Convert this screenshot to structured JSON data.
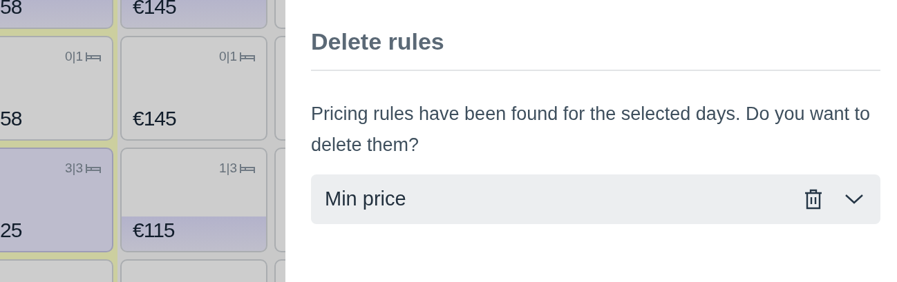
{
  "calendar": {
    "rows": [
      {
        "cells": [
          {
            "price": "58",
            "selected": false,
            "rule": true
          },
          {
            "price": "€145",
            "selected": false,
            "rule": true
          }
        ]
      },
      {
        "cells": [
          {
            "availability": "0|1",
            "price": "58",
            "selected": false,
            "rule": false
          },
          {
            "availability": "0|1",
            "price": "€145",
            "selected": false,
            "rule": false
          }
        ]
      },
      {
        "cells": [
          {
            "availability": "3|3",
            "price": "25",
            "selected": true,
            "rule": false
          },
          {
            "availability": "1|3",
            "price": "€115",
            "selected": false,
            "rule": true
          }
        ]
      },
      {
        "cells": [
          {
            "selected": false,
            "rule": false
          },
          {
            "selected": false,
            "rule": false
          }
        ]
      }
    ]
  },
  "dialog": {
    "title": "Delete rules",
    "message": "Pricing rules have been found for the selected days. Do you want to delete them?",
    "rules": [
      {
        "label": "Min price",
        "expanded": false
      }
    ]
  }
}
